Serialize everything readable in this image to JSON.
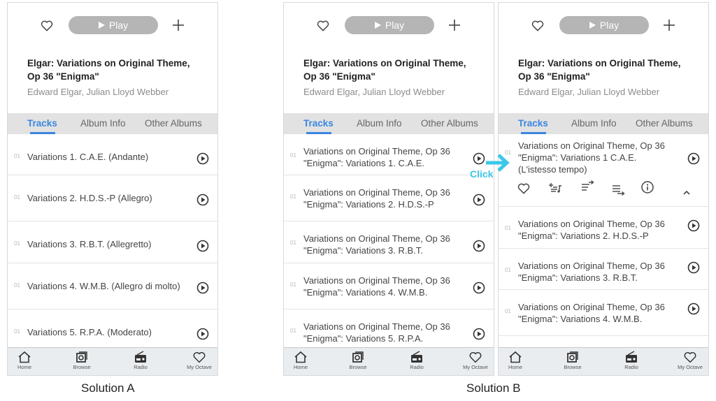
{
  "album": {
    "play_label": "Play",
    "title_line1": "Elgar: Variations on Original Theme,",
    "title_line2": "Op 36 \"Enigma\"",
    "artist": "Edward Elgar, Julian Lloyd Webber"
  },
  "tabs": [
    {
      "label": "Tracks",
      "active": true
    },
    {
      "label": "Album Info",
      "active": false
    },
    {
      "label": "Other Albums",
      "active": false
    }
  ],
  "nav": [
    {
      "label": "Home",
      "icon": "home-icon"
    },
    {
      "label": "Browse",
      "icon": "browse-icon"
    },
    {
      "label": "Radio",
      "icon": "radio-icon"
    },
    {
      "label": "My Octave",
      "icon": "heart-icon"
    }
  ],
  "solutionA": {
    "caption": "Solution A",
    "tracks": [
      {
        "num": "01",
        "title": "Variations 1. C.A.E. (Andante)"
      },
      {
        "num": "01",
        "title": "Variations 2. H.D.S.-P (Allegro)"
      },
      {
        "num": "01",
        "title": "Variations 3. R.B.T. (Allegretto)"
      },
      {
        "num": "01",
        "title": "Variations 4. W.M.B. (Allegro di molto)"
      },
      {
        "num": "01",
        "title": "Variations 5. R.P.A. (Moderato)"
      }
    ]
  },
  "solutionB": {
    "caption": "Solution B",
    "click_label": "Click",
    "tracks_collapsed": [
      {
        "num": "01",
        "line1": "Variations on Original Theme, Op 36",
        "line2": "\"Enigma\": Variations 1. C.A.E."
      },
      {
        "num": "01",
        "line1": "Variations on Original Theme, Op 36",
        "line2": "\"Enigma\": Variations 2. H.D.S.-P"
      },
      {
        "num": "01",
        "line1": "Variations on Original Theme, Op 36",
        "line2": "\"Enigma\": Variations 3. R.B.T."
      },
      {
        "num": "01",
        "line1": "Variations on Original Theme, Op 36",
        "line2": "\"Enigma\": Variations 4. W.M.B."
      },
      {
        "num": "01",
        "line1": "Variations on Original Theme, Op 36",
        "line2": "\"Enigma\": Variations 5. R.P.A."
      }
    ],
    "expanded_track": {
      "num": "01",
      "line1": "Variations on Original Theme, Op 36",
      "line2": "\"Enigma\": Variations 1 C.A.E.",
      "line3": "(L'istesso tempo)"
    },
    "expanded_actions": [
      "heart-icon",
      "add-to-playlist-icon",
      "play-next-icon",
      "add-to-queue-icon",
      "info-icon",
      "chevron-up-icon"
    ],
    "tracks_after": [
      {
        "num": "01",
        "line1": "Variations on Original Theme, Op 36",
        "line2": "\"Enigma\": Variations 2. H.D.S.-P"
      },
      {
        "num": "01",
        "line1": "Variations on Original Theme, Op 36",
        "line2": "\"Enigma\": Variations 3. R.B.T."
      },
      {
        "num": "01",
        "line1": "Variations on Original Theme, Op 36",
        "line2": "\"Enigma\": Variations 4. W.M.B."
      }
    ]
  },
  "colors": {
    "accent": "#3a86e0",
    "click": "#3cc7e8",
    "play_button": "#b5b5b5",
    "tabs_bg": "#e2e2e2",
    "nav_bg": "#eaedf0"
  }
}
